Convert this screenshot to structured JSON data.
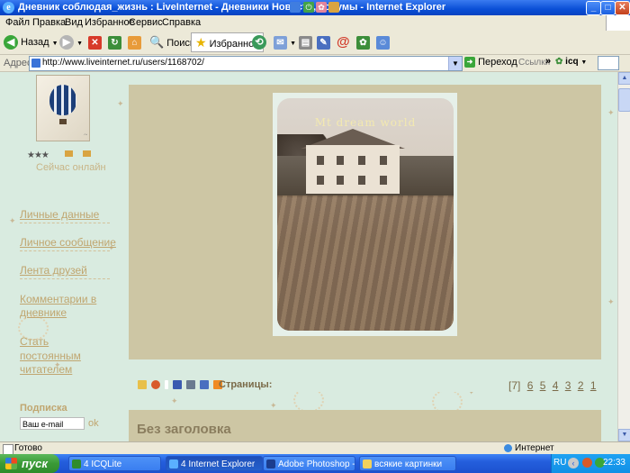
{
  "window": {
    "title": "Дневник соблюдая_жизнь : LiveInternet - Дневники Новости,Форумы - Internet Explorer",
    "controls": {
      "minimize": "_",
      "maximize": "□",
      "close": "✕"
    }
  },
  "menu": {
    "items": [
      "Файл",
      "Правка",
      "Вид",
      "Избранное",
      "Сервис",
      "Справка"
    ]
  },
  "toolbar": {
    "back_label": "Назад",
    "search_label": "Поиск",
    "favorites_label": "Избранное"
  },
  "address": {
    "label": "Адрес:",
    "url": "http://www.liveinternet.ru/users/1168702/",
    "go_label": "Переход",
    "links_label": "Ссылки",
    "icq_label": "icq"
  },
  "sidebar": {
    "online_text": "Сейчас онлайн",
    "nav": [
      {
        "label": "Личные данные"
      },
      {
        "label": "Личное сообщение"
      },
      {
        "label": "Лента друзей"
      },
      {
        "label": "Комментарии в"
      },
      {
        "label": "дневнике"
      },
      {
        "label": "Стать"
      },
      {
        "label": "постоянным"
      },
      {
        "label": "читателем"
      }
    ],
    "subscribe_label": "Подписка",
    "email_placeholder": "Ваш e-mail",
    "ok_label": "ok"
  },
  "post": {
    "image_caption": "Mt dream world",
    "pages_label": "Страницы:",
    "pages": [
      "[7]",
      "6",
      "5",
      "4",
      "3",
      "2",
      "1"
    ],
    "second_post_title": "Без заголовка"
  },
  "statusbar": {
    "text": "Готово",
    "zone": "Интернет"
  },
  "taskbar": {
    "start_label": "пуск",
    "tasks": [
      {
        "label": "4 ICQLite",
        "color": "#2f8c2b"
      },
      {
        "label": "4 Internet Explorer",
        "color": "#5ab0ff"
      },
      {
        "label": "Adobe Photoshop - [...",
        "color": "#1b3d8f"
      },
      {
        "label": "всякие картинки",
        "color": "#f2d15c"
      }
    ],
    "lang": "RU",
    "clock": "22:33"
  },
  "colors": {
    "accent": "#0a4fd6",
    "page_bg": "#d9ebe0",
    "panel": "#cdc6a4",
    "link": "#c0a670"
  }
}
